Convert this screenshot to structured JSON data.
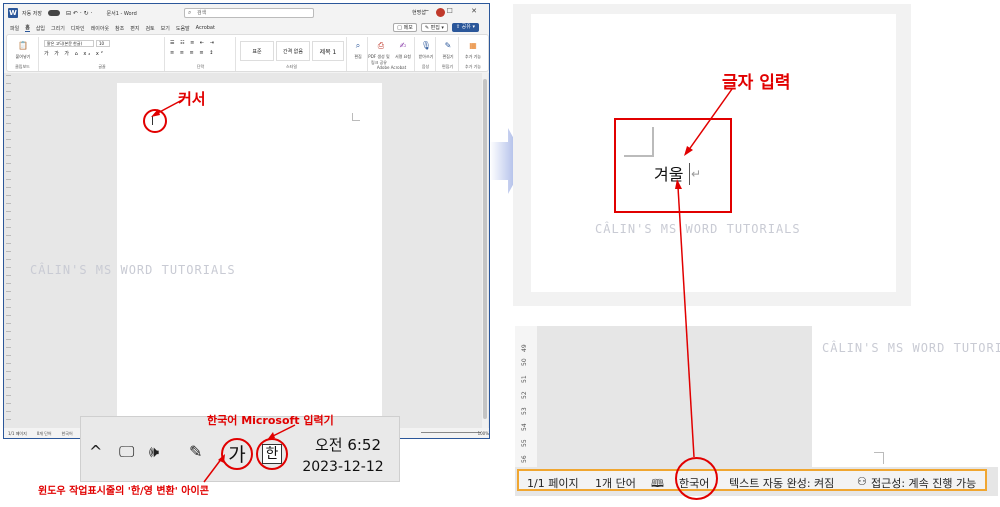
{
  "word": {
    "titlebar": {
      "autosave": "자동 저장",
      "toggle_state": "끔",
      "qat": "⊟ ↶ · ↻ ·",
      "doc_title": "문서1 - Word",
      "search_placeholder": "검색",
      "user": "현명섭 ",
      "window_buttons": "─ ☐ ✕"
    },
    "menu_tabs": [
      "파일",
      "홈",
      "삽입",
      "그리기",
      "디자인",
      "레이아웃",
      "참조",
      "편지",
      "검토",
      "보기",
      "도움말",
      "Acrobat"
    ],
    "menu_right": {
      "memo": "□ 메모",
      "edit": "✎ 편집 ▾",
      "share": "⇧ 공유 ▾"
    },
    "ribbon": {
      "font_name": "맑은 고딕(본문 한글)",
      "font_size": "10",
      "format_row": "가 가 가 ⌂ x₂ x²",
      "style_normal": "표준",
      "style_nospace": "간격 없음",
      "style_heading1": "제목 1",
      "groups": [
        "클립보드",
        "글꼴",
        "단락",
        "스타일",
        "Adobe Acrobat",
        "음성",
        "편집기",
        "추가 기능"
      ],
      "btn_paste": "붙여넣기",
      "btn_find": "편집",
      "btn_pdf": "PDF 생성 및 링크 공유",
      "btn_sign": "서명 요청",
      "btn_dictate": "받아쓰기",
      "btn_editor": "편집기",
      "btn_addins": "추가 기능"
    },
    "status": {
      "page": "1/1 페이지",
      "words": "0개 단어",
      "lang": "한국어",
      "zoom": "100%"
    }
  },
  "annotations": {
    "cursor": "커서",
    "ime": "한국어 Microsoft 입력기",
    "taskbar_icon": "윈도우 작업표시줄의 '한/영 변환' 아이콘",
    "typing": "글자 입력"
  },
  "watermark": "CÂLIN'S MS WORD TUTORIALS",
  "taskbar": {
    "chevron": "^",
    "monitor_icon": "🖵",
    "volume_icon": "🕪",
    "pen_icon": "✎",
    "ga": "가",
    "han": "한",
    "time": "오전 6:52",
    "date": "2023-12-12"
  },
  "zoom_doc": {
    "text": "겨울",
    "para_mark": "↵"
  },
  "status_zoom": {
    "ruler_ticks": [
      "56",
      "55",
      "54",
      "53",
      "52",
      "51",
      "50",
      "49"
    ],
    "page": "1/1 페이지",
    "words": "1개 단어",
    "book_icon": "🕮",
    "lang": "한국어",
    "autocomplete": "텍스트 자동 완성: 켜짐",
    "accessibility_icon": "⚇",
    "accessibility": "접근성: 계속 진행 가능"
  },
  "colors": {
    "annotation_red": "#e10000",
    "word_blue": "#2b579a",
    "status_border": "#f0a630"
  }
}
